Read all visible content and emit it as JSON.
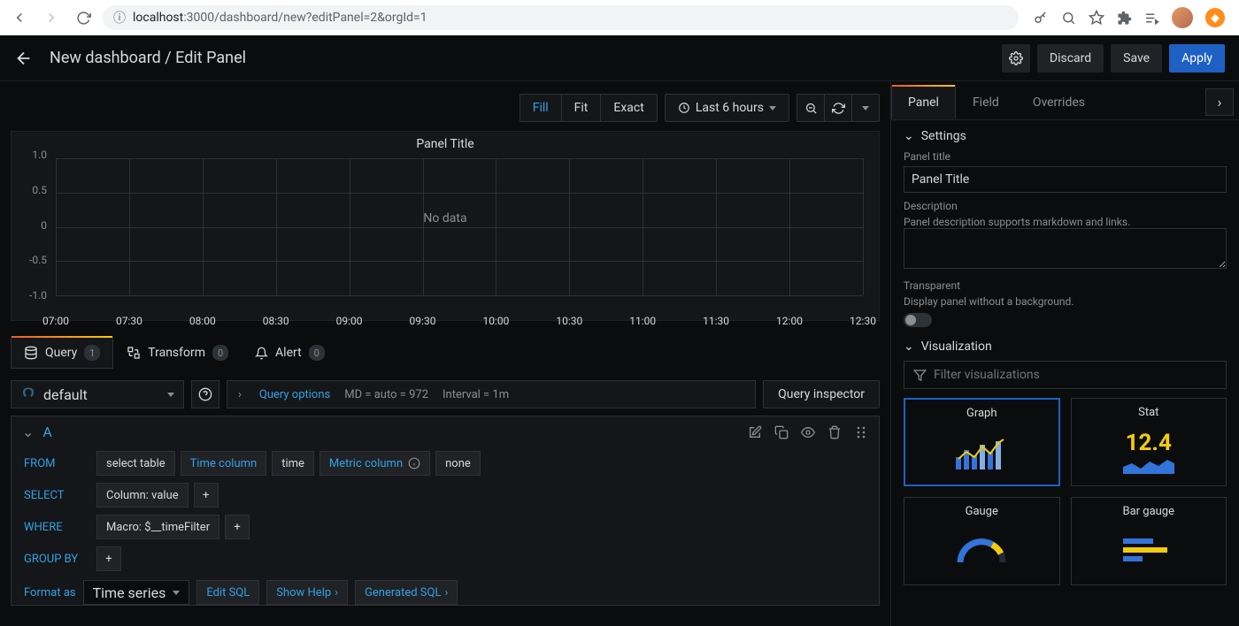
{
  "browser": {
    "url_host": "localhost",
    "url_port_path": ":3000/dashboard/new?editPanel=2&orgId=1"
  },
  "topbar": {
    "title": "New dashboard / Edit Panel",
    "discard": "Discard",
    "save": "Save",
    "apply": "Apply"
  },
  "preview_toolbar": {
    "fill": "Fill",
    "fit": "Fit",
    "exact": "Exact",
    "time_range": "Last 6 hours"
  },
  "panel": {
    "title": "Panel Title",
    "no_data": "No data",
    "y_ticks": [
      "1.0",
      "0.5",
      "0",
      "-0.5",
      "-1.0"
    ],
    "x_ticks": [
      "07:00",
      "07:30",
      "08:00",
      "08:30",
      "09:00",
      "09:30",
      "10:00",
      "10:30",
      "11:00",
      "11:30",
      "12:00",
      "12:30"
    ]
  },
  "query_tabs": {
    "query": {
      "label": "Query",
      "count": "1"
    },
    "transform": {
      "label": "Transform",
      "count": "0"
    },
    "alert": {
      "label": "Alert",
      "count": "0"
    }
  },
  "datasource": {
    "name": "default",
    "options_label": "Query options",
    "md": "MD = auto = 972",
    "interval": "Interval = 1m",
    "inspector": "Query inspector"
  },
  "queryA": {
    "ref": "A",
    "from": "FROM",
    "select_table": "select table",
    "time_col_label": "Time column",
    "time_col_val": "time",
    "metric_col_label": "Metric column",
    "metric_col_val": "none",
    "select": "SELECT",
    "select_val": "Column: value",
    "where": "WHERE",
    "where_val": "Macro: $__timeFilter",
    "groupby": "GROUP BY",
    "format_as": "Format as",
    "format_val": "Time series",
    "edit_sql": "Edit SQL",
    "show_help": "Show Help",
    "gen_sql": "Generated SQL"
  },
  "side": {
    "tabs": {
      "panel": "Panel",
      "field": "Field",
      "overrides": "Overrides"
    },
    "settings": {
      "heading": "Settings",
      "title_label": "Panel title",
      "title_value": "Panel Title",
      "desc_label": "Description",
      "desc_hint": "Panel description supports markdown and links.",
      "transparent_label": "Transparent",
      "transparent_hint": "Display panel without a background."
    },
    "viz": {
      "heading": "Visualization",
      "filter_placeholder": "Filter visualizations",
      "cards": {
        "graph": "Graph",
        "stat": "Stat",
        "gauge": "Gauge",
        "bar_gauge": "Bar gauge"
      },
      "stat_value": "12.4"
    }
  },
  "chart_data": {
    "type": "line",
    "title": "Panel Title",
    "series": [],
    "ylim": [
      -1.0,
      1.0
    ],
    "x_range": [
      "07:00",
      "12:30"
    ],
    "note": "No data"
  }
}
